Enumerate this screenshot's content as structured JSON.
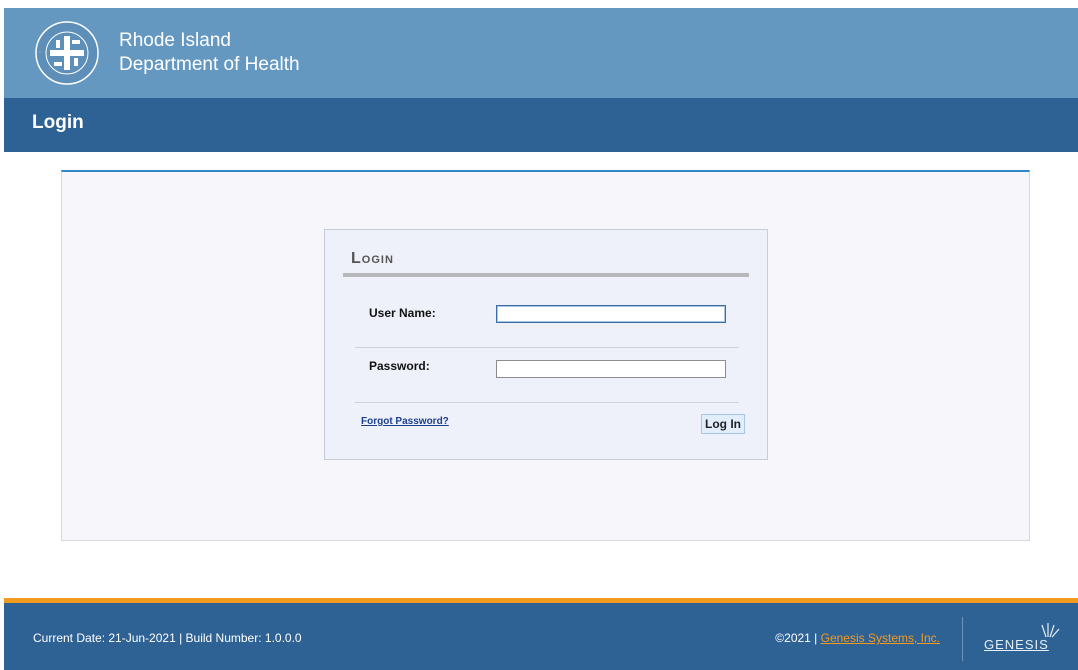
{
  "banner": {
    "agency_line1": "Rhode Island",
    "agency_line2": "Department of Health",
    "seal_icon": "ri-doh-seal-icon"
  },
  "titlebar": {
    "title": "Login"
  },
  "login": {
    "heading": "Login",
    "username_label": "User Name:",
    "username_value": "",
    "password_label": "Password:",
    "password_value": "",
    "forgot_link": "Forgot Password?",
    "submit_label": "Log In"
  },
  "footer": {
    "status_text": "Current Date: 21-Jun-2021 | Build Number: 1.0.0.0",
    "copyright": "©2021 | ",
    "vendor_name": "Genesis Systems, Inc.",
    "vendor_logo_text": "GENESIS",
    "vendor_logo_icon": "sunburst-icon"
  },
  "colors": {
    "banner": "#6598c0",
    "titlebar": "#2f6294",
    "footer_stripe": "#f19a1d",
    "accent_link": "#f39a1f"
  }
}
